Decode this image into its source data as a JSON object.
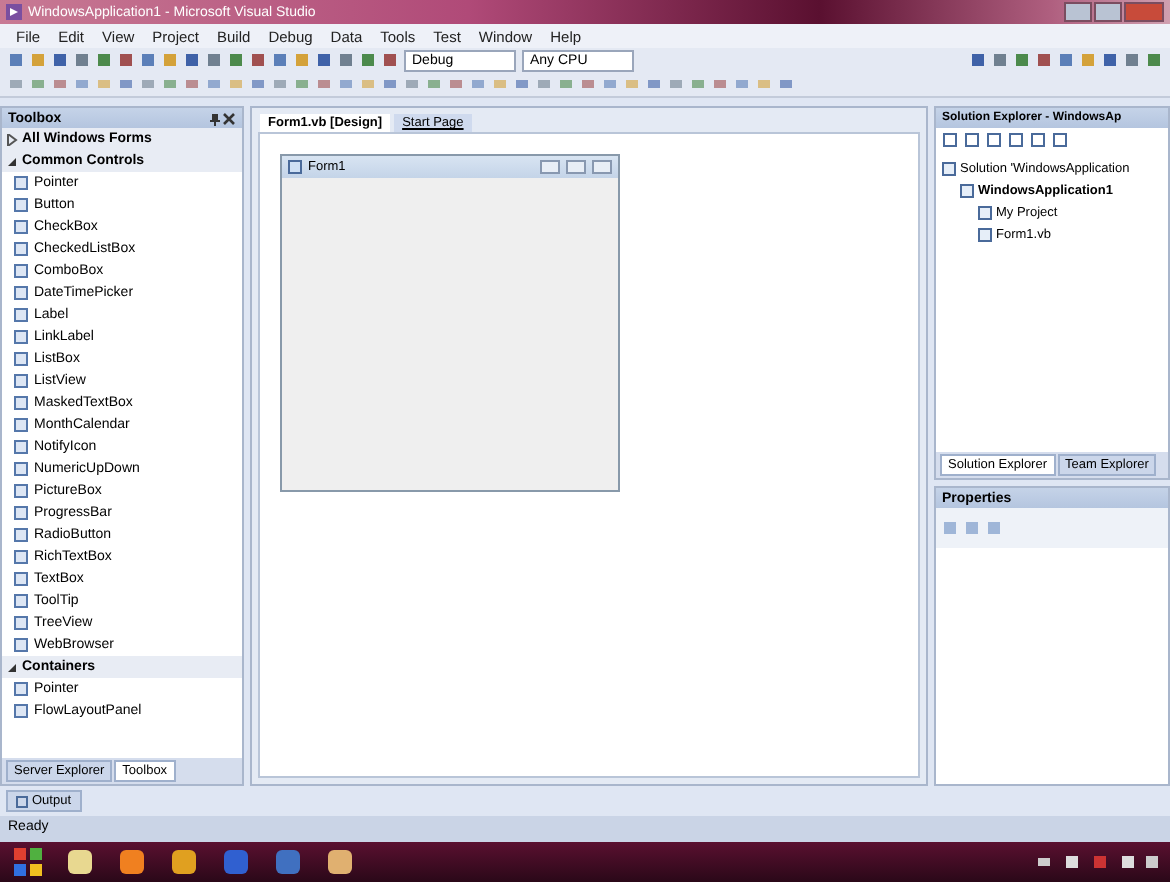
{
  "window": {
    "title": "WindowsApplication1 - Microsoft Visual Studio"
  },
  "menu": [
    "File",
    "Edit",
    "View",
    "Project",
    "Build",
    "Debug",
    "Data",
    "Tools",
    "Test",
    "Window",
    "Help"
  ],
  "toolbar": {
    "configuration": "Debug",
    "platform": "Any CPU"
  },
  "toolbox": {
    "title": "Toolbox",
    "groups": [
      {
        "label": "All Windows Forms",
        "expanded": false
      },
      {
        "label": "Common Controls",
        "expanded": true,
        "items": [
          "Pointer",
          "Button",
          "CheckBox",
          "CheckedListBox",
          "ComboBox",
          "DateTimePicker",
          "Label",
          "LinkLabel",
          "ListBox",
          "ListView",
          "MaskedTextBox",
          "MonthCalendar",
          "NotifyIcon",
          "NumericUpDown",
          "PictureBox",
          "ProgressBar",
          "RadioButton",
          "RichTextBox",
          "TextBox",
          "ToolTip",
          "TreeView",
          "WebBrowser"
        ]
      },
      {
        "label": "Containers",
        "expanded": true,
        "items": [
          "Pointer",
          "FlowLayoutPanel"
        ]
      }
    ],
    "tabs": [
      {
        "label": "Server Explorer",
        "selected": false
      },
      {
        "label": "Toolbox",
        "selected": true
      }
    ]
  },
  "document_tabs": [
    {
      "label": "Form1.vb [Design]",
      "selected": true
    },
    {
      "label": "Start Page",
      "selected": false
    }
  ],
  "form": {
    "title": "Form1"
  },
  "solution_explorer": {
    "title": "Solution Explorer - WindowsAp",
    "tree": [
      {
        "label": "Solution 'WindowsApplication",
        "bold": false,
        "children": [
          {
            "label": "WindowsApplication1",
            "bold": true,
            "children": [
              {
                "label": "My Project",
                "bold": false
              },
              {
                "label": "Form1.vb",
                "bold": false
              }
            ]
          }
        ]
      }
    ],
    "tabs": [
      {
        "label": "Solution Explorer",
        "selected": true
      },
      {
        "label": "Team Explorer",
        "selected": false
      }
    ]
  },
  "properties": {
    "title": "Properties"
  },
  "output_tab": "Output",
  "status": "Ready"
}
